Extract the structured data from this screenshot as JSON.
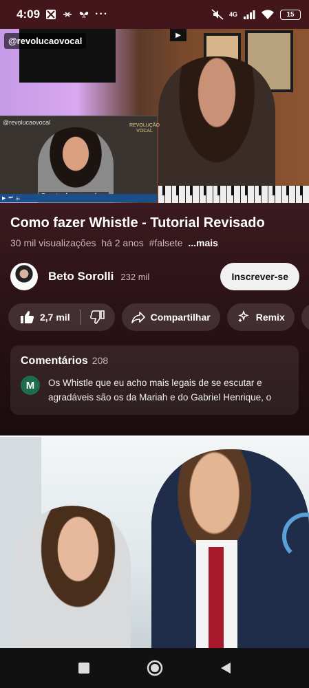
{
  "status_bar": {
    "time": "4:09",
    "network": "4G",
    "battery": "15"
  },
  "video": {
    "channel_tag": "@revolucaovocal",
    "inset_handle": "@revolucaovocal",
    "inset_logo": "REVOLUÇÃO VOCAL",
    "subtitle": "Quarto: fazer pra fora"
  },
  "info": {
    "title": "Como fazer Whistle - Tutorial Revisado",
    "views": "30 mil visualizações",
    "age": "há 2 anos",
    "hashtag": "#falsete",
    "more": "...mais"
  },
  "channel": {
    "name": "Beto Sorolli",
    "subscribers": "232 mil",
    "subscribe_label": "Inscrever-se"
  },
  "actions": {
    "like_count": "2,7 mil",
    "share_label": "Compartilhar",
    "remix_label": "Remix"
  },
  "comments": {
    "title": "Comentários",
    "count": "208",
    "first_avatar": "M",
    "first_text": "Os Whistle que eu acho mais legais de se escutar e agradáveis são os da Mariah e do Gabriel Henrique, o do..."
  },
  "colors": {
    "header_bg": "#43161c",
    "subscribe_bg": "#f1f1f1",
    "comment_avatar": "#1e6b4d"
  }
}
